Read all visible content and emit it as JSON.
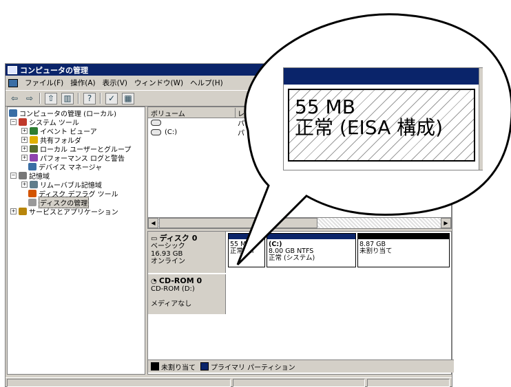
{
  "window": {
    "title": "コンピュータの管理",
    "menus": [
      "ファイル(F)",
      "操作(A)",
      "表示(V)",
      "ウィンドウ(W)",
      "ヘルプ(H)"
    ]
  },
  "tree": [
    {
      "label": "コンピュータの管理 (ローカル)",
      "icon": "computer-icon"
    },
    {
      "label": "システム ツール",
      "icon": "tools-icon"
    },
    {
      "label": "イベント ビューア",
      "icon": "event-viewer-icon"
    },
    {
      "label": "共有フォルダ",
      "icon": "shared-folder-icon"
    },
    {
      "label": "ローカル ユーザーとグループ",
      "icon": "users-icon"
    },
    {
      "label": "パフォーマンス ログと警告",
      "icon": "performance-icon"
    },
    {
      "label": "デバイス マネージャ",
      "icon": "device-manager-icon"
    },
    {
      "label": "記憶域",
      "icon": "storage-icon"
    },
    {
      "label": "リムーバブル記憶域",
      "icon": "removable-storage-icon"
    },
    {
      "label": "ディスク デフラグ ツール",
      "icon": "defrag-icon"
    },
    {
      "label": "ディスクの管理",
      "icon": "disk-management-icon"
    },
    {
      "label": "サービスとアプリケーション",
      "icon": "services-icon"
    }
  ],
  "volumes": {
    "col_volume": "ボリューム",
    "col_layout_partial": "レ",
    "rows": [
      {
        "name": "",
        "type_partial": "パ"
      },
      {
        "name": "(C:)",
        "type_partial": "パ"
      }
    ]
  },
  "disk0": {
    "name": "ディスク 0",
    "type": "ベーシック",
    "size": "16.93 GB",
    "status": "オンライン",
    "partitions": [
      {
        "line1": "",
        "line2": "55 MB",
        "line3": "正常 (EI",
        "bar_color": "#0a246a"
      },
      {
        "line1": "(C:)",
        "line2": "8.00 GB NTFS",
        "line3": "正常 (システム)",
        "bar_color": "#0a246a"
      },
      {
        "line1": "",
        "line2": "8.87 GB",
        "line3": "未割り当て",
        "bar_color": "#000000"
      }
    ]
  },
  "cdrom0": {
    "name": "CD-ROM 0",
    "drive": "CD-ROM (D:)",
    "status": "メディアなし"
  },
  "legend": [
    {
      "label": "未割り当て",
      "color": "#000000"
    },
    {
      "label": "プライマリ パーティション",
      "color": "#0a246a"
    }
  ],
  "zoom": {
    "line1": "55 MB",
    "line2": "正常 (EISA 構成)"
  }
}
